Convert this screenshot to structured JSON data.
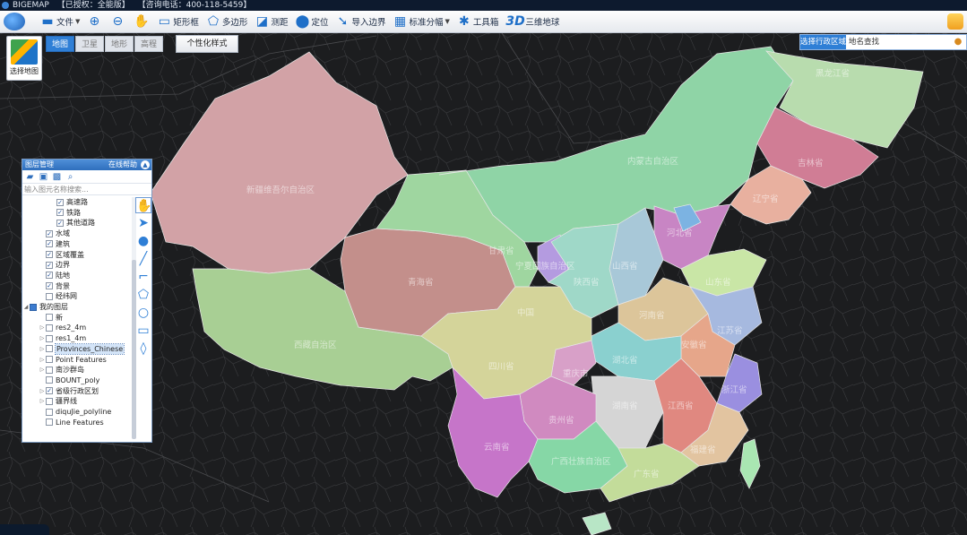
{
  "title_bar": {
    "app": "BIGEMAP",
    "license": "【已授权：全能版】",
    "hotline": "【咨询电话：400-118-5459】"
  },
  "toolbar": {
    "file": "文件",
    "rect": "矩形框",
    "polygon": "多边形",
    "measure": "测距",
    "locate": "定位",
    "import_boundary": "导入边界",
    "tile_split": "标准分幅",
    "toolbox": "工具箱",
    "three_d_mark": "3D",
    "globe": "三维地球"
  },
  "map_types": {
    "select_label": "选择地图",
    "items": [
      "地图",
      "卫星",
      "地形",
      "高程"
    ],
    "active": "地图",
    "style_button": "个性化样式"
  },
  "search": {
    "tag": "选择行政区域",
    "placeholder": "地名查找"
  },
  "panel": {
    "title": "图层管理",
    "help": "在线帮助",
    "filter_placeholder": "输入图元名称搜索...",
    "tree": [
      {
        "label": "高速路",
        "checked": true
      },
      {
        "label": "铁路",
        "checked": true
      },
      {
        "label": "其他道路",
        "checked": true
      },
      {
        "label": "水域",
        "checked": true
      },
      {
        "label": "建筑",
        "checked": true
      },
      {
        "label": "区域覆盖",
        "checked": true
      },
      {
        "label": "边界",
        "checked": true
      },
      {
        "label": "陆地",
        "checked": true
      },
      {
        "label": "背景",
        "checked": true
      },
      {
        "label": "经纬网",
        "checked": false
      },
      {
        "label": "我的图层",
        "checked": "partial"
      },
      {
        "label": "新",
        "checked": false
      },
      {
        "label": "res2_4m",
        "checked": false
      },
      {
        "label": "res1_4m",
        "checked": false
      },
      {
        "label": "Provinces_Chinese",
        "checked": false,
        "selected": true
      },
      {
        "label": "Point Features",
        "checked": false
      },
      {
        "label": "南沙群岛",
        "checked": false
      },
      {
        "label": "BOUNT_poly",
        "checked": false
      },
      {
        "label": "省级行政区划",
        "checked": true
      },
      {
        "label": "疆界线",
        "checked": false
      },
      {
        "label": "diquJie_polyline",
        "checked": false
      },
      {
        "label": "Line Features",
        "checked": false
      }
    ]
  },
  "draw_tools": [
    "hand-icon",
    "pointer-icon",
    "marker-icon",
    "line-icon",
    "polyline-icon",
    "polygon-icon",
    "circle-icon",
    "rectangle-icon",
    "eraser-icon"
  ],
  "map": {
    "province_labels": [
      "黑龙江省",
      "吉林省",
      "辽宁省",
      "内蒙古自治区",
      "新疆维吾尔自治区",
      "甘肃省",
      "宁夏回族自治区",
      "山西省",
      "河北省",
      "山东省",
      "青海省",
      "陕西省",
      "中国",
      "河南省",
      "安徽省",
      "江苏省",
      "西藏自治区",
      "四川省",
      "湖北省",
      "浙江省",
      "重庆市",
      "湖南省",
      "江西省",
      "贵州省",
      "福建省",
      "云南省",
      "广西壮族自治区",
      "广东省"
    ],
    "colors": {
      "xinjiang": "#d2a2a6",
      "tibet": "#a8cf94",
      "qinghai": "#c38f8b",
      "inner_mongolia": "#8fd4a6",
      "heilongjiang": "#b8dcae",
      "jilin": "#d07d95",
      "yunnan": "#c675c9",
      "sichuan": "#d4d49a",
      "henan": "#dcc59a",
      "sea_blue": "#2f7fd6"
    }
  }
}
